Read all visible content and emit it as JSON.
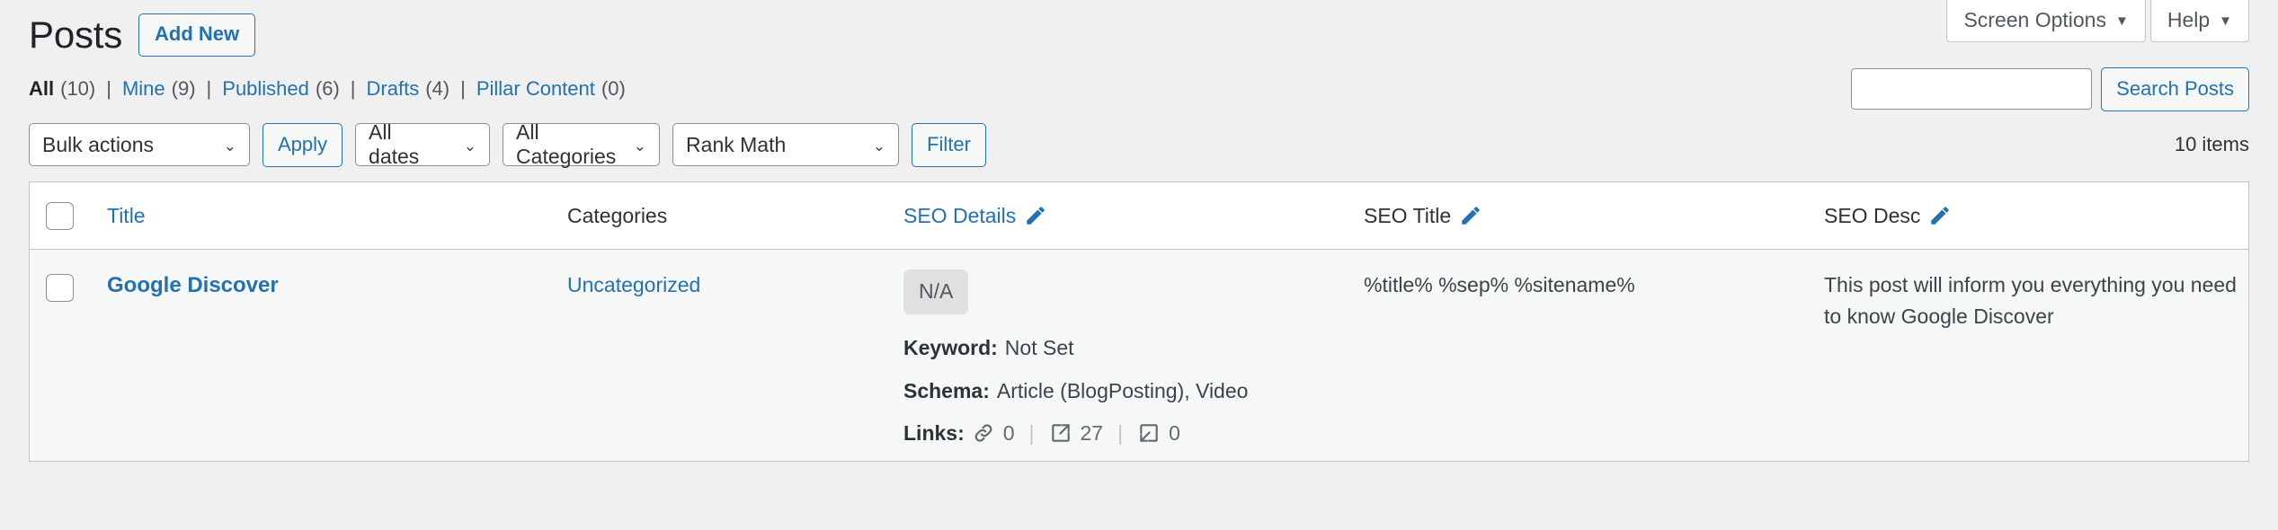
{
  "screen_meta": {
    "tabs": [
      {
        "label": "Screen Options",
        "icon": "chevron-down-icon"
      },
      {
        "label": "Help",
        "icon": "chevron-down-icon"
      }
    ]
  },
  "header": {
    "title": "Posts",
    "add_new_label": "Add New"
  },
  "status_filters": [
    {
      "label": "All",
      "count": "(10)",
      "current": true
    },
    {
      "label": "Mine",
      "count": "(9)",
      "current": false
    },
    {
      "label": "Published",
      "count": "(6)",
      "current": false
    },
    {
      "label": "Drafts",
      "count": "(4)",
      "current": false
    },
    {
      "label": "Pillar Content",
      "count": "(0)",
      "current": false
    }
  ],
  "separator": "|",
  "search": {
    "value": "",
    "placeholder": "",
    "button_label": "Search Posts"
  },
  "tablenav": {
    "bulk_actions": "Bulk actions",
    "apply_label": "Apply",
    "dates_filter": "All dates",
    "categories_filter": "All Categories",
    "rank_math_filter": "Rank Math",
    "filter_label": "Filter",
    "items_count": "10 items"
  },
  "table": {
    "columns": [
      {
        "key": "cb",
        "label": "",
        "style": "checkbox"
      },
      {
        "key": "title",
        "label": "Title",
        "style": "link",
        "edit_icon": false
      },
      {
        "key": "categories",
        "label": "Categories",
        "style": "static",
        "edit_icon": false
      },
      {
        "key": "seo_details",
        "label": "SEO Details",
        "style": "link",
        "edit_icon": true
      },
      {
        "key": "seo_title",
        "label": "SEO Title",
        "style": "static",
        "edit_icon": true
      },
      {
        "key": "seo_desc",
        "label": "SEO Desc",
        "style": "static",
        "edit_icon": true
      }
    ],
    "rows": [
      {
        "title": "Google Discover",
        "category": "Uncategorized",
        "seo_score_badge": "N/A",
        "keyword_label": "Keyword:",
        "keyword_value": "Not Set",
        "schema_label": "Schema:",
        "schema_value": "Article (BlogPosting), Video",
        "links_label": "Links:",
        "links": [
          {
            "icon": "chain-link-icon",
            "count": "0"
          },
          {
            "icon": "external-link-icon",
            "count": "27"
          },
          {
            "icon": "inbound-link-icon",
            "count": "0"
          }
        ],
        "seo_title": "%title% %sep% %sitename%",
        "seo_desc": "This post will inform you everything you need to know Google Discover"
      }
    ]
  },
  "colors": {
    "link": "#2271b1",
    "text": "#3c434a",
    "heading": "#1d2327",
    "page_bg": "#f0f0f1",
    "row_bg": "#f6f7f7",
    "border": "#c3c4c7",
    "badge_bg": "#e0e0e0"
  }
}
